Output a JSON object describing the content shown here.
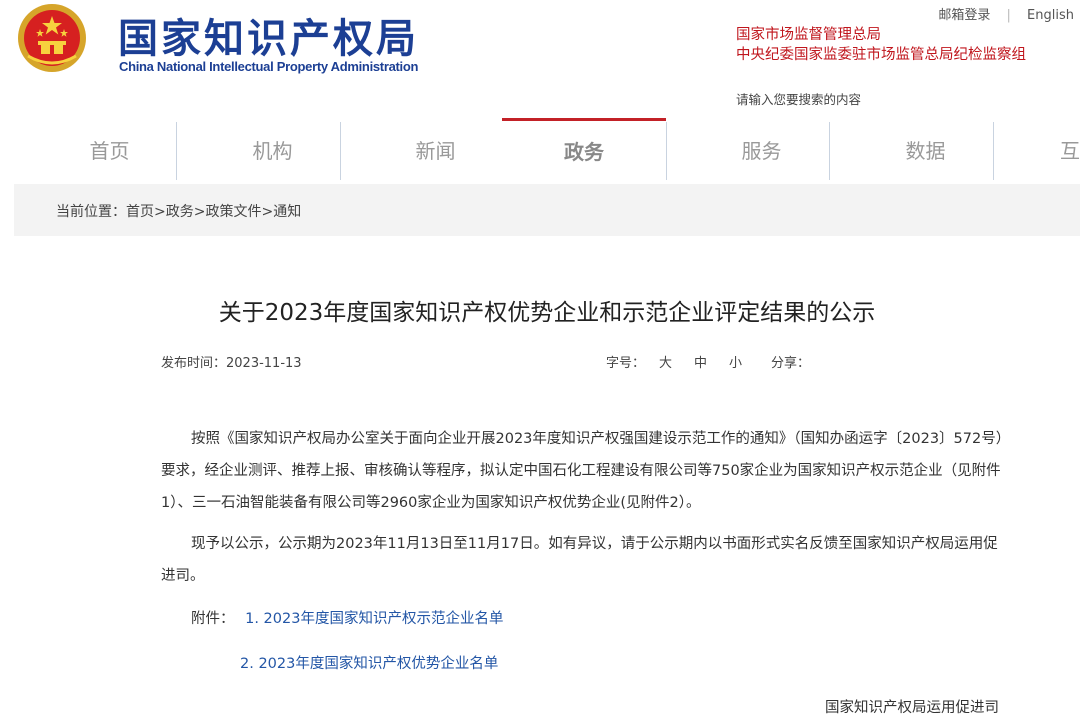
{
  "header": {
    "logo_cn": "国家知识产权局",
    "logo_en": "China National Intellectual Property Administration",
    "login": "邮箱登录",
    "language": "English",
    "supervisor_1": "国家市场监督管理总局",
    "supervisor_2": "中央纪委国家监委驻市场监管总局纪检监察组",
    "search_placeholder": "请输入您要搜索的内容"
  },
  "nav": {
    "items": [
      {
        "label": "首页"
      },
      {
        "label": "机构"
      },
      {
        "label": "新闻"
      },
      {
        "label": "政务",
        "active": true
      },
      {
        "label": "服务"
      },
      {
        "label": "数据"
      },
      {
        "label": "互"
      }
    ],
    "active_color": "#c32127"
  },
  "breadcrumb": {
    "prefix": "当前位置：",
    "items": [
      "首页",
      "政务",
      "政策文件",
      "通知"
    ],
    "separator": ">"
  },
  "article": {
    "title": "关于2023年度国家知识产权优势企业和示范企业评定结果的公示",
    "publish_label": "发布时间：",
    "publish_date": "2023-11-13",
    "font_label": "字号：",
    "font_large": "大",
    "font_medium": "中",
    "font_small": "小",
    "share_label": "分享：",
    "paragraph_1": "按照《国家知识产权局办公室关于面向企业开展2023年度知识产权强国建设示范工作的通知》（国知办函运字〔2023〕572号）要求，经企业测评、推荐上报、审核确认等程序，拟认定中国石化工程建设有限公司等750家企业为国家知识产权示范企业（见附件1）、三一石油智能装备有限公司等2960家企业为国家知识产权优势企业(见附件2）。",
    "paragraph_2": "现予以公示，公示期为2023年11月13日至11月17日。如有异议，请于公示期内以书面形式实名反馈至国家知识产权局运用促进司。",
    "attachments_label": "附件：",
    "attachment_1": "1. 2023年度国家知识产权示范企业名单",
    "attachment_2": "2. 2023年度国家知识产权优势企业名单",
    "signature": "国家知识产权局运用促进司"
  },
  "colors": {
    "brand_blue": "#1c3f94",
    "supervisor_red": "#c0161d",
    "link_blue": "#2356a6"
  },
  "icons": [
    "national-emblem-icon"
  ]
}
